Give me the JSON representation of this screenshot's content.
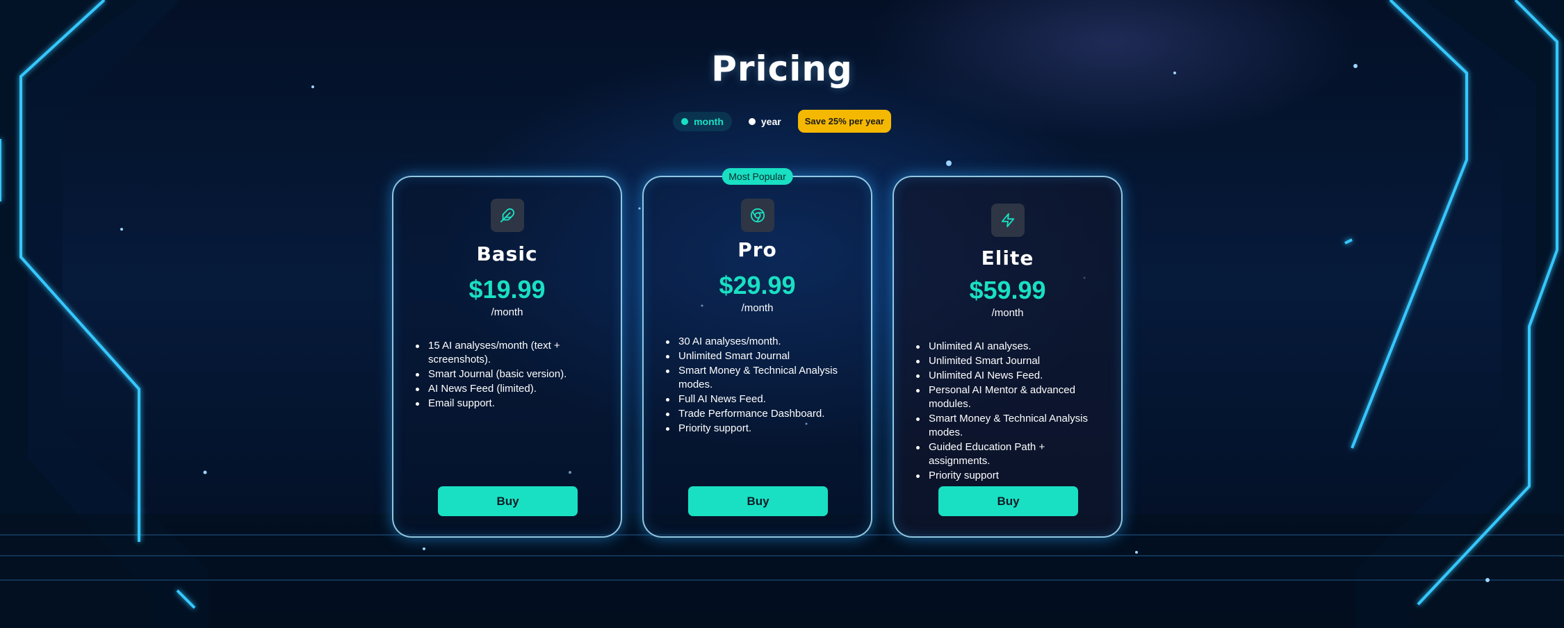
{
  "page": {
    "title": "Pricing"
  },
  "billing_toggle": {
    "month_label": "month",
    "year_label": "year",
    "selected": "month",
    "save_badge": "Save 25% per year"
  },
  "plans": [
    {
      "name": "Basic",
      "icon": "feather-icon",
      "price": "$19.99",
      "period": "/month",
      "features": [
        "15 AI analyses/month (text + screenshots).",
        "Smart Journal (basic version).",
        "AI News Feed (limited).",
        "Email support."
      ],
      "button": "Buy"
    },
    {
      "name": "Pro",
      "icon": "chrome-icon",
      "badge": "Most Popular",
      "price": "$29.99",
      "period": "/month",
      "features": [
        "30 AI analyses/month.",
        "Unlimited Smart Journal",
        "Smart Money & Technical Analysis modes.",
        "Full AI News Feed.",
        "Trade Performance Dashboard.",
        "Priority support."
      ],
      "button": "Buy"
    },
    {
      "name": "Elite",
      "icon": "lightning-icon",
      "price": "$59.99",
      "period": "/month",
      "features": [
        "Unlimited AI analyses.",
        "Unlimited Smart Journal",
        "Unlimited AI News Feed.",
        "Personal AI Mentor & advanced modules.",
        "Smart Money & Technical Analysis modes.",
        "Guided Education Path + assignments.",
        "Priority support"
      ],
      "button": "Buy"
    }
  ],
  "colors": {
    "accent": "#19e0c3",
    "badge": "#f5b800",
    "card_border": "#aae6ff",
    "background": "#061a3a"
  }
}
